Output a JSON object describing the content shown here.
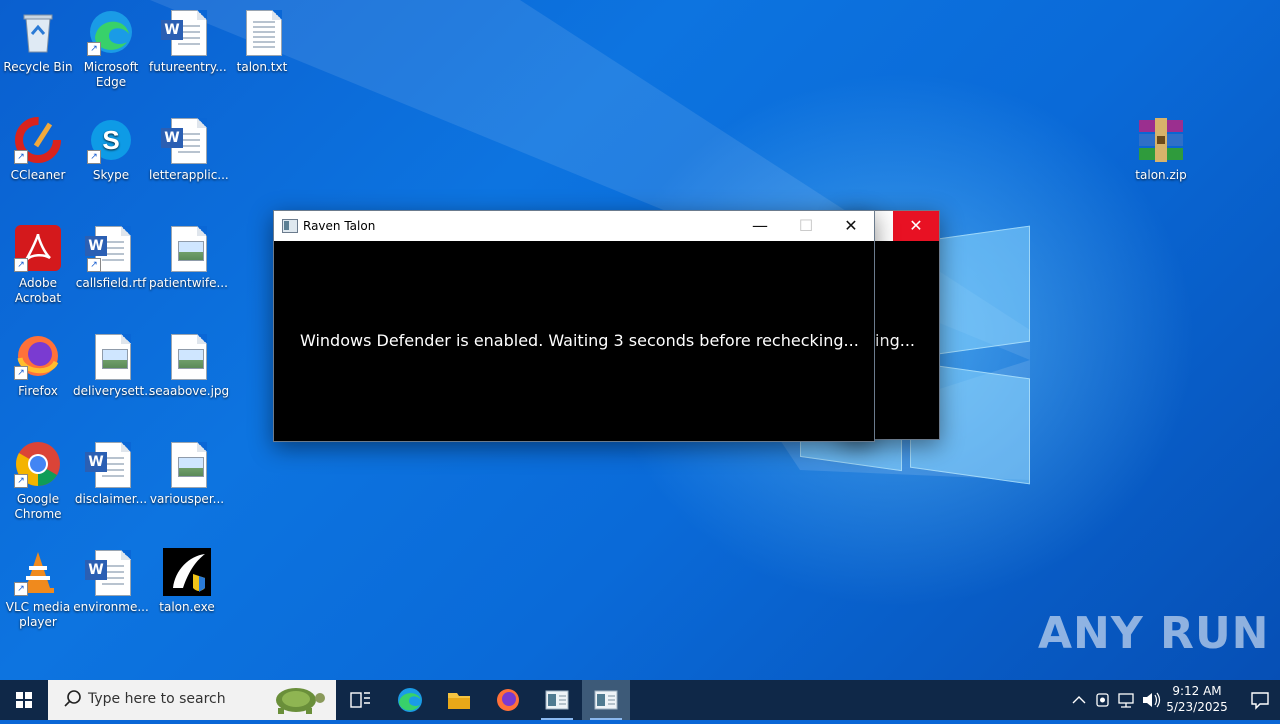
{
  "desktop": {
    "icons": [
      {
        "label": "Recycle Bin"
      },
      {
        "label": "Microsoft Edge"
      },
      {
        "label": "futureentry..."
      },
      {
        "label": "talon.txt"
      },
      {
        "label": "CCleaner"
      },
      {
        "label": "Skype"
      },
      {
        "label": "letterapplic..."
      },
      {
        "label": "talon.zip"
      },
      {
        "label": "Adobe Acrobat"
      },
      {
        "label": "callsfield.rtf"
      },
      {
        "label": "patientwife..."
      },
      {
        "label": "Firefox"
      },
      {
        "label": "deliverysett..."
      },
      {
        "label": "seaabove.jpg"
      },
      {
        "label": "Google Chrome"
      },
      {
        "label": "disclaimer..."
      },
      {
        "label": "variousper..."
      },
      {
        "label": "VLC media player"
      },
      {
        "label": "environme..."
      },
      {
        "label": "talon.exe"
      }
    ],
    "watermark": "ANY RUN"
  },
  "back_window": {
    "text": "ing..."
  },
  "front_window": {
    "title": "Raven Talon",
    "message": "Windows Defender is enabled. Waiting 3 seconds before rechecking..."
  },
  "taskbar": {
    "search_placeholder": "Type here to search",
    "time": "9:12 AM",
    "date": "5/23/2025"
  },
  "colors": {
    "desktop_accent": "#0a67d6",
    "close_hover": "#e81123",
    "taskbar": "#0f2848"
  }
}
